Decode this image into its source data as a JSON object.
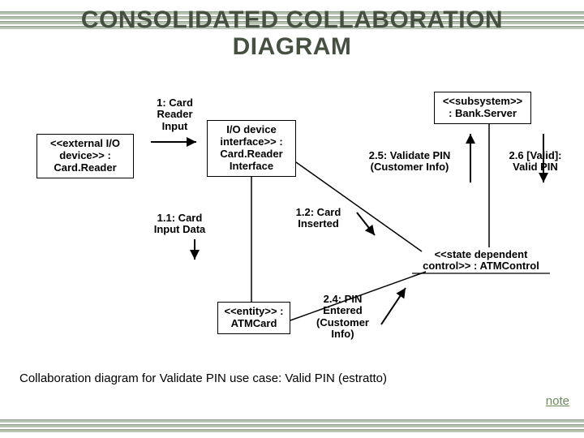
{
  "title_line1": "CONSOLIDATED COLLABORATION",
  "title_line2": "DIAGRAM",
  "nodes": {
    "card_reader": "<<external I/O\ndevice>>\n: Card.Reader",
    "io_interface": "I/O device\ninterface>>\n: Card.Reader\nInterface",
    "bank_server": "<<subsystem>>\n: Bank.Server",
    "atm_card": "<<entity>>\n: ATMCard",
    "atm_control": "<<state dependent\ncontrol>> : ATMControl"
  },
  "labels": {
    "m1": "1: Card\nReader\nInput",
    "m11": "1.1: Card\nInput Data",
    "m12": "1.2: Card\nInserted",
    "m25": "2.5: Validate PIN\n(Customer Info)",
    "m26": "2.6 [Valid]:\nValid PIN",
    "m24": "2.4: PIN\nEntered\n(Customer\nInfo)"
  },
  "caption": "Collaboration diagram for Validate  PIN use case: Valid PIN (estratto)",
  "note": "note"
}
